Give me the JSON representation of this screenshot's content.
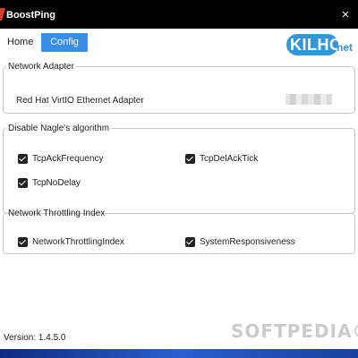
{
  "window": {
    "title": "BoostPing",
    "close_glyph": "×"
  },
  "tabs": [
    {
      "label": "Home",
      "active": false
    },
    {
      "label": "Config",
      "active": true
    }
  ],
  "logo": {
    "text": "KILHO",
    "suffix": "net"
  },
  "network_adapter": {
    "legend": "Network Adapter",
    "name": "Red Hat VirtIO Ethernet Adapter"
  },
  "nagle": {
    "legend": "Disable Nagle's algorithm",
    "options": [
      {
        "label": "TcpAckFrequency",
        "checked": true
      },
      {
        "label": "TcpDelAckTick",
        "checked": true
      },
      {
        "label": "TcpNoDelay",
        "checked": true
      }
    ]
  },
  "throttling": {
    "legend": "Network Throttling Index",
    "options": [
      {
        "label": "NetworkThrottlingIndex",
        "checked": true
      },
      {
        "label": "SystemResponsiveness",
        "checked": true
      }
    ]
  },
  "footer": {
    "version": "Version: 1.4.5.0"
  },
  "watermark": "SOFTPEDIA®",
  "colors": {
    "accent": "#3a8ee6",
    "logo_blue": "#3595d9",
    "titlebar": "#000000"
  }
}
